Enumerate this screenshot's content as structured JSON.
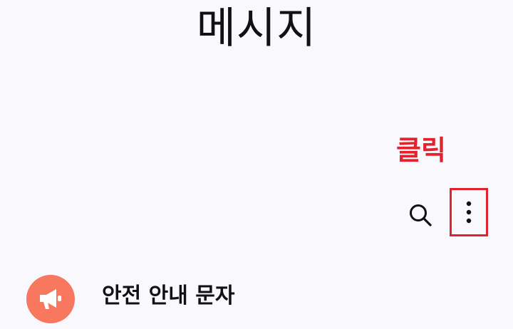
{
  "header": {
    "title": "메시지"
  },
  "annotation": {
    "text": "클릭",
    "color": "#e0242f"
  },
  "toolbar": {
    "search_icon": "search-icon",
    "more_icon": "more-vertical-icon"
  },
  "conversations": [
    {
      "title": "안전 안내 문자",
      "icon": "megaphone-icon",
      "avatar_color": "#f7775f"
    }
  ]
}
